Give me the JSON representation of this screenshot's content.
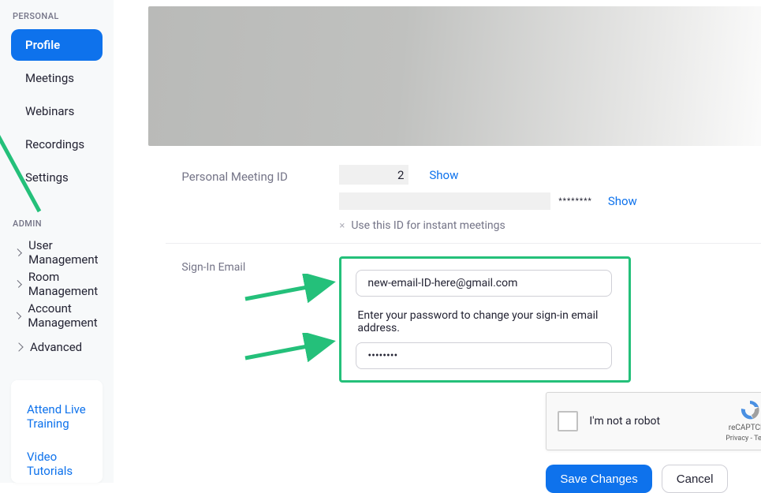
{
  "sidebar": {
    "personal_label": "PERSONAL",
    "items": [
      {
        "label": "Profile"
      },
      {
        "label": "Meetings"
      },
      {
        "label": "Webinars"
      },
      {
        "label": "Recordings"
      },
      {
        "label": "Settings"
      }
    ],
    "admin_label": "ADMIN",
    "admin_items": [
      {
        "label": "User Management"
      },
      {
        "label": "Room Management"
      },
      {
        "label": "Account Management"
      },
      {
        "label": "Advanced"
      }
    ],
    "help_links": [
      "Attend Live Training",
      "Video Tutorials"
    ]
  },
  "profile": {
    "pmi_label": "Personal Meeting ID",
    "pmi_digit": "2",
    "show": "Show",
    "instant_text": "Use this ID for instant meetings",
    "signin_label": "Sign-In Email",
    "email_value": "new-email-ID-here@gmail.com",
    "password_hint": "Enter your password to change your sign-in email address.",
    "password_dots": "••••••••",
    "captcha_text": "I'm not a robot",
    "captcha_brand": "reCAPTCHA",
    "captcha_privacy": "Privacy",
    "captcha_terms": "Terms",
    "save": "Save Changes",
    "cancel": "Cancel"
  }
}
